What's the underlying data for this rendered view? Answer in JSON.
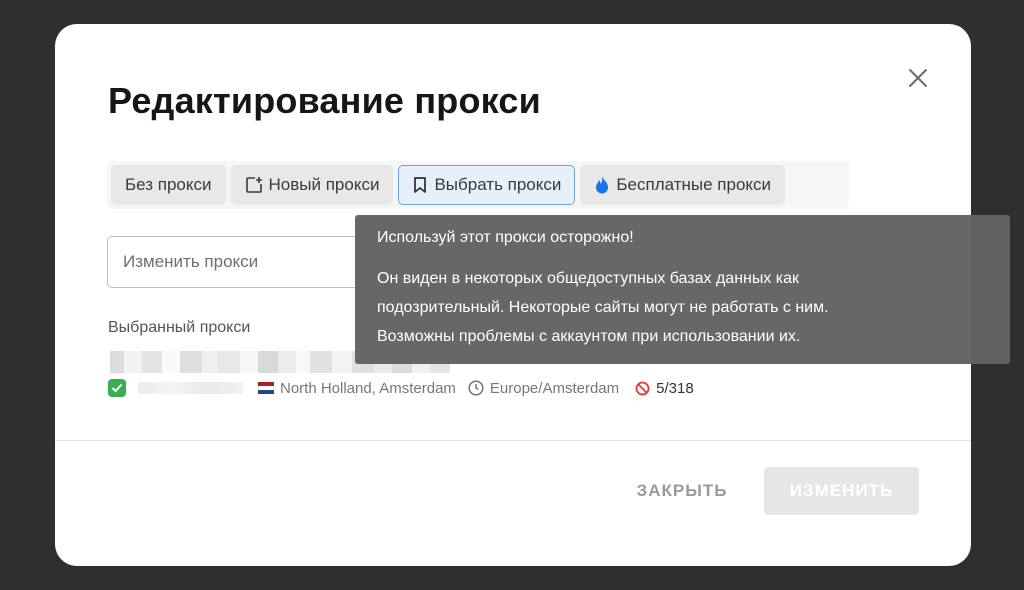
{
  "modal": {
    "title": "Редактирование прокси",
    "close_icon": "close-icon"
  },
  "tabs": [
    {
      "label": "Без прокси",
      "icon": null,
      "active": false
    },
    {
      "label": "Новый прокси",
      "icon": "add-window-icon",
      "active": false
    },
    {
      "label": "Выбрать прокси",
      "icon": "bookmark-icon",
      "active": true
    },
    {
      "label": "Бесплатные прокси",
      "icon": "flame-icon",
      "active": false
    }
  ],
  "select": {
    "placeholder": "Изменить прокси",
    "icon": "chevron-down-icon"
  },
  "selected_proxy": {
    "label": "Выбранный прокси",
    "status_icon": "check-icon",
    "location": "North Holland, Amsterdam",
    "timezone": "Europe/Amsterdam",
    "usage": "5/318",
    "country_flag": "netherlands-flag-icon"
  },
  "tooltip": {
    "title": "Используй этот прокси осторожно!",
    "lines": [
      "Он виден в некоторых общедоступных базах данных как",
      "подозрительный. Некоторые сайты могут не работать с ним.",
      "Возможны проблемы с аккаунтом при использовании их."
    ]
  },
  "footer": {
    "close_label": "ЗАКРЫТЬ",
    "change_label": "ИЗМЕНИТЬ"
  },
  "colors": {
    "backdrop": "#2f2f2f",
    "accent_border": "#6aa3df",
    "check_green": "#3cae52",
    "flame_blue": "#1a73e8",
    "ban_red": "#e53935"
  }
}
